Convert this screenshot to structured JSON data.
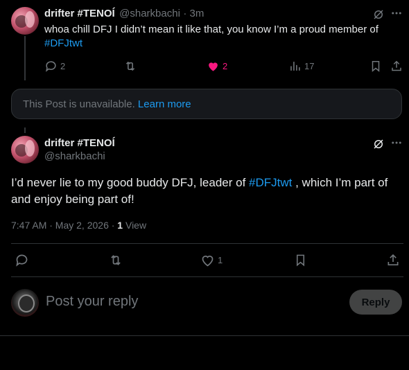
{
  "parent_post": {
    "display_name": "drifter #TENOÍ",
    "handle": "@sharkbachi",
    "time": "3m",
    "text_main": "whoa chill DFJ I didn’t mean it like that, you know I’m a proud member of",
    "hashtag": "#DFJtwt",
    "replies": "2",
    "likes": "2",
    "views": "17"
  },
  "unavailable": {
    "text": "This Post is unavailable.",
    "link": "Learn more"
  },
  "main_post": {
    "display_name": "drifter #TENOÍ",
    "handle": "@sharkbachi",
    "text_before": "I’d never lie to my good buddy DFJ, leader of",
    "hashtag": "#DFJtwt",
    "text_after": ", which I’m part of and enjoy being part of!",
    "timestamp": "7:47 AM · May 2, 2026 ·",
    "views_count": "1",
    "views_label": "View",
    "likes": "1"
  },
  "composer": {
    "placeholder": "Post your reply",
    "reply_label": "Reply"
  },
  "colors": {
    "accent": "#1d9bf0",
    "like_active": "#f91880",
    "muted": "#71767b"
  }
}
